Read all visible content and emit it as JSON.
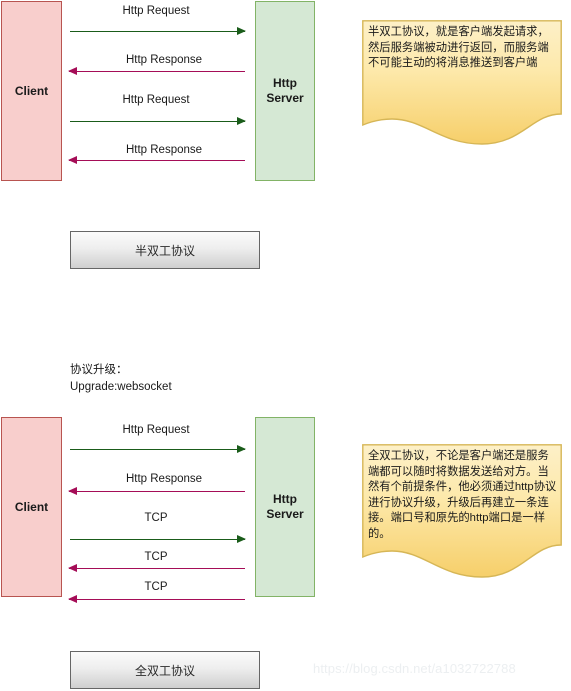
{
  "diagram": {
    "watermark": "https://blog.csdn.net/a1032722788",
    "section_half_duplex": {
      "client_label": "Client",
      "server_label": "Http\nServer",
      "messages": [
        {
          "label": "Http Request",
          "direction": "to-right"
        },
        {
          "label": "Http Response",
          "direction": "to-left"
        },
        {
          "label": "Http Request",
          "direction": "to-right"
        },
        {
          "label": "Http Response",
          "direction": "to-left"
        }
      ],
      "summary_label": "半双工协议",
      "note_text": "半双工协议，就是客户端发起请求，然后服务端被动进行返回，而服务端不可能主动的将消息推送到客户端"
    },
    "upgrade_annotation": "协议升级：\nUpgrade:websocket",
    "section_full_duplex": {
      "client_label": "Client",
      "server_label": "Http\nServer",
      "messages": [
        {
          "label": "Http Request",
          "direction": "to-right"
        },
        {
          "label": "Http Response",
          "direction": "to-left"
        },
        {
          "label": "TCP",
          "direction": "to-right"
        },
        {
          "label": "TCP",
          "direction": "to-left"
        },
        {
          "label": "TCP",
          "direction": "to-left"
        }
      ],
      "summary_label": "全双工协议",
      "note_text": "全双工协议，不论是客户端还是服务端都可以随时将数据发送给对方。当然有个前提条件，他必须通过http协议\n进行协议升级，升级后再建立一条连接。端口号和原先的http端口是一样的。"
    },
    "colors": {
      "client_fill": "#f8cecc",
      "client_stroke": "#b85450",
      "server_fill": "#d5e8d4",
      "server_stroke": "#82b366",
      "request_arrow": "#1a5c1a",
      "response_arrow": "#a50d57",
      "note_fill": "#ffe6a0",
      "note_stroke": "#d6b656",
      "summary_stroke": "#666666"
    }
  }
}
